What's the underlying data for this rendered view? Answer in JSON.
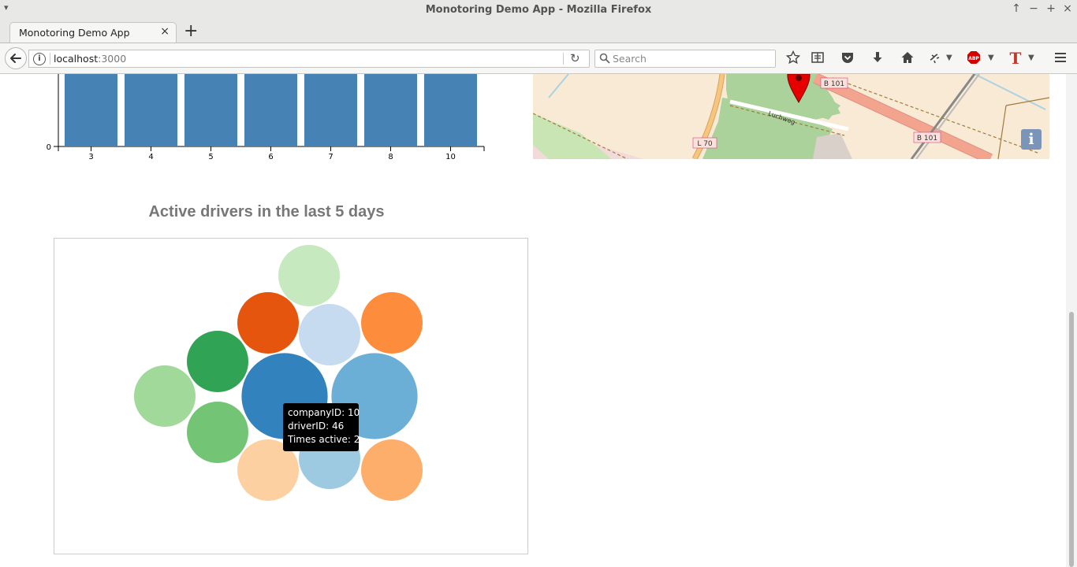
{
  "window": {
    "title": "Monotoring Demo App - Mozilla Firefox"
  },
  "tabs": [
    {
      "label": "Monotoring Demo App",
      "close": "×"
    }
  ],
  "new_tab": "+",
  "navbar": {
    "url_host": "localhost",
    "url_port": ":3000",
    "search_placeholder": "Search"
  },
  "toolbar_icons": [
    "star-icon",
    "reading-list-icon",
    "pocket-icon",
    "download-icon",
    "home-icon",
    "extension-icon",
    "adblock-plus-icon",
    "t-extension-icon",
    "hamburger-menu-icon"
  ],
  "colors": {
    "bar": "#4682b4",
    "map_land": "#f9ead6",
    "map_green": "#acd29b",
    "map_road": "#f2a48e",
    "marker": "#e60000",
    "tooltip_bg": "#000000",
    "title_text": "#777777"
  },
  "map": {
    "labels": [
      "B 101",
      "B 101",
      "L 70",
      "Luchweg"
    ],
    "info_button": "i"
  },
  "chart_data": [
    {
      "type": "bar",
      "categories": [
        "3",
        "4",
        "5",
        "6",
        "7",
        "8",
        "10"
      ],
      "y_tick_labels": [
        "0"
      ],
      "cropped": "top of chart scrolled out of view"
    },
    {
      "type": "bubble",
      "title": "Active drivers in the last 5 days",
      "bubbles": [
        {
          "color": "#c7e9c0",
          "relative_size": 1.0
        },
        {
          "color": "#e6550d",
          "relative_size": 1.0
        },
        {
          "color": "#c6dbef",
          "relative_size": 1.0
        },
        {
          "color": "#fd8d3c",
          "relative_size": 1.0
        },
        {
          "color": "#31a354",
          "relative_size": 1.0
        },
        {
          "color": "#a1d99b",
          "relative_size": 1.0
        },
        {
          "color": "#3182bd",
          "relative_size": 1.4
        },
        {
          "color": "#6baed6",
          "relative_size": 1.4
        },
        {
          "color": "#74c476",
          "relative_size": 1.0
        },
        {
          "color": "#fdd0a2",
          "relative_size": 1.0
        },
        {
          "color": "#9ecae1",
          "relative_size": 1.0
        },
        {
          "color": "#fdae6b",
          "relative_size": 1.0
        }
      ],
      "tooltip": {
        "line1": "companyID: 10",
        "line2": "driverID: 46",
        "line3": "Times active: 2"
      }
    }
  ]
}
